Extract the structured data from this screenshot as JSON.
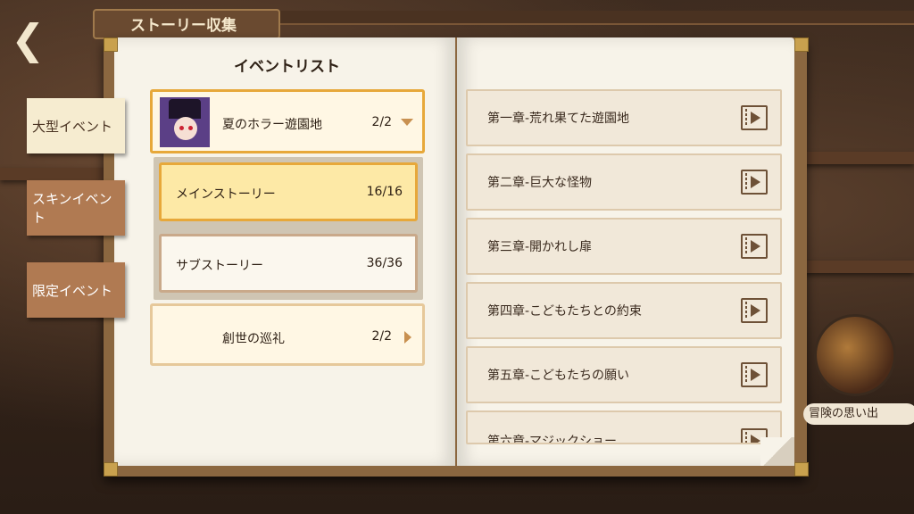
{
  "header": {
    "title": "ストーリー収集"
  },
  "side_tabs": [
    {
      "label": "大型イベント",
      "active": true
    },
    {
      "label": "スキンイベント",
      "active": false
    },
    {
      "label": "限定イベント",
      "active": false
    }
  ],
  "left_page": {
    "title": "イベントリスト",
    "events": [
      {
        "name": "夏のホラー遊園地",
        "progress": "2/2",
        "expanded": true
      },
      {
        "name": "創世の巡礼",
        "progress": "2/2",
        "expanded": false
      }
    ],
    "sub_items": [
      {
        "label": "メインストーリー",
        "progress": "16/16",
        "active": true
      },
      {
        "label": "サブストーリー",
        "progress": "36/36",
        "active": false
      }
    ]
  },
  "chapters": [
    "第一章-荒れ果てた遊園地",
    "第二章-巨大な怪物",
    "第三章-開かれし扉",
    "第四章-こどもたちとの約束",
    "第五章-こどもたちの願い",
    "第六章-マジックショー"
  ],
  "footer": {
    "memories_label": "冒険の思い出"
  },
  "colors": {
    "accent": "#e7a83a",
    "page": "#f7f3e9",
    "highlight": "#fde9a6"
  }
}
